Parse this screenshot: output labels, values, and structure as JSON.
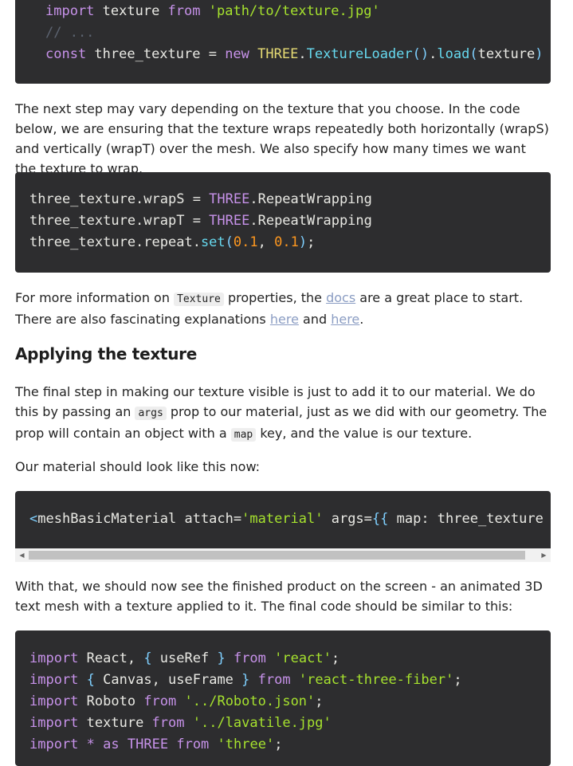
{
  "block1": {
    "lines": [
      [
        [
          "kw",
          "import"
        ],
        [
          "op",
          " texture "
        ],
        [
          "kw",
          "from"
        ],
        [
          "op",
          " "
        ],
        [
          "str",
          "'path/to/texture.jpg'"
        ]
      ],
      [
        [
          "cmt",
          "// ..."
        ]
      ],
      [
        [
          "kw",
          "const"
        ],
        [
          "op",
          " three_texture = "
        ],
        [
          "kw",
          "new"
        ],
        [
          "op",
          " "
        ],
        [
          "cls",
          "THREE"
        ],
        [
          "op",
          "."
        ],
        [
          "fn",
          "TextureLoader"
        ],
        [
          "pn",
          "()"
        ],
        [
          "op",
          "."
        ],
        [
          "fn",
          "load"
        ],
        [
          "pn",
          "("
        ],
        [
          "op",
          "texture"
        ],
        [
          "pn",
          ")"
        ]
      ]
    ]
  },
  "para1": "The next step may vary depending on the texture that you choose. In the code below, we are ensuring that the texture wraps repeatedly both horizontally (wrapS) and vertically (wrapT) over the mesh. We also specify how many times we want the texture to wrap.",
  "block2": {
    "lines": [
      [
        [
          "op",
          "three_texture.wrapS = "
        ],
        [
          "kw",
          "THREE"
        ],
        [
          "op",
          ".RepeatWrapping"
        ]
      ],
      [
        [
          "op",
          "three_texture.wrapT = "
        ],
        [
          "kw",
          "THREE"
        ],
        [
          "op",
          ".RepeatWrapping"
        ]
      ],
      [
        [
          "op",
          "three_texture.repeat."
        ],
        [
          "fn",
          "set"
        ],
        [
          "pn",
          "("
        ],
        [
          "num",
          "0.1"
        ],
        [
          "op",
          ", "
        ],
        [
          "num",
          "0.1"
        ],
        [
          "pn",
          ")"
        ],
        [
          "op",
          ";"
        ]
      ]
    ]
  },
  "para2": {
    "before": "For more information on ",
    "code": "Texture",
    "mid": " properties, the ",
    "link1": "docs",
    "after1": " are a great place to start. There are also fascinating explanations ",
    "link2": "here",
    "and": " and ",
    "link3": "here",
    "end": "."
  },
  "heading": "Applying the texture",
  "para3": {
    "t1": "The final step in making our texture visible is just to add it to our material. We do this by passing an ",
    "c1": "args",
    "t2": " prop to our material, just as we did with our geometry. The prop will contain an object with a ",
    "c2": "map",
    "t3": " key, and the value is our texture."
  },
  "para4": "Our material should look like this now:",
  "block3": {
    "lines": [
      [
        [
          "pn",
          "<"
        ],
        [
          "op",
          "meshBasicMaterial attach="
        ],
        [
          "str",
          "'material'"
        ],
        [
          "op",
          " args="
        ],
        [
          "pn",
          "{{"
        ],
        [
          "op",
          " map: three_texture "
        ],
        [
          "pn",
          "}}"
        ]
      ]
    ]
  },
  "para5": "With that, we should now see the finished product on the screen - an animated 3D text mesh with a texture applied to it. The final code should be similar to this:",
  "block4": {
    "lines": [
      [
        [
          "kw",
          "import"
        ],
        [
          "op",
          " React, "
        ],
        [
          "pn",
          "{"
        ],
        [
          "op",
          " useRef "
        ],
        [
          "pn",
          "}"
        ],
        [
          "op",
          " "
        ],
        [
          "kw",
          "from"
        ],
        [
          "op",
          " "
        ],
        [
          "str",
          "'react'"
        ],
        [
          "op",
          ";"
        ]
      ],
      [
        [
          "kw",
          "import"
        ],
        [
          "op",
          " "
        ],
        [
          "pn",
          "{"
        ],
        [
          "op",
          " Canvas, useFrame "
        ],
        [
          "pn",
          "}"
        ],
        [
          "op",
          " "
        ],
        [
          "kw",
          "from"
        ],
        [
          "op",
          " "
        ],
        [
          "str",
          "'react-three-fiber'"
        ],
        [
          "op",
          ";"
        ]
      ],
      [
        [
          "kw",
          "import"
        ],
        [
          "op",
          " Roboto "
        ],
        [
          "kw",
          "from"
        ],
        [
          "op",
          " "
        ],
        [
          "str",
          "'../Roboto.json'"
        ],
        [
          "op",
          ";"
        ]
      ],
      [
        [
          "kw",
          "import"
        ],
        [
          "op",
          " texture "
        ],
        [
          "kw",
          "from"
        ],
        [
          "op",
          " "
        ],
        [
          "str",
          "'../lavatile.jpg'"
        ]
      ],
      [
        [
          "kw",
          "import"
        ],
        [
          "op",
          " "
        ],
        [
          "kw",
          "*"
        ],
        [
          "op",
          " "
        ],
        [
          "kw",
          "as"
        ],
        [
          "op",
          " "
        ],
        [
          "kw",
          "THREE"
        ],
        [
          "op",
          " "
        ],
        [
          "kw",
          "from"
        ],
        [
          "op",
          " "
        ],
        [
          "str",
          "'three'"
        ],
        [
          "op",
          ";"
        ]
      ]
    ]
  },
  "colors": {
    "code_bg": "#2d2d2f",
    "keyword": "#c792ea",
    "string": "#a6e22e",
    "link": "#8b9dc3"
  }
}
